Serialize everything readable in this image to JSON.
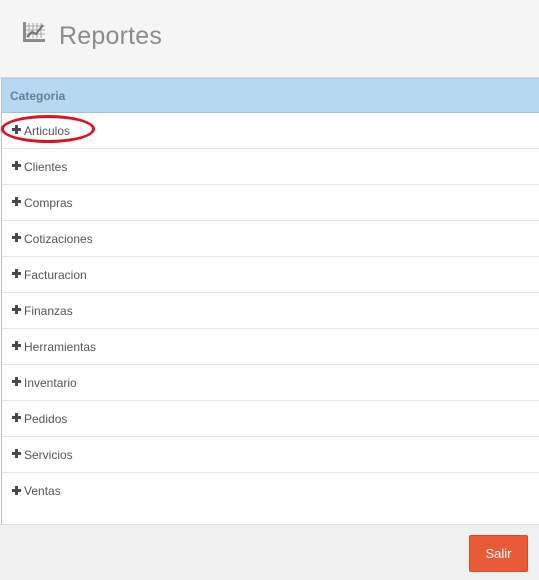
{
  "header": {
    "icon": "report-chart-icon",
    "title": "Reportes"
  },
  "table": {
    "column_header": "Categoria",
    "rows": [
      {
        "icon": "plus-icon",
        "label": "Articulos"
      },
      {
        "icon": "plus-icon",
        "label": "Clientes"
      },
      {
        "icon": "plus-icon",
        "label": "Compras"
      },
      {
        "icon": "plus-icon",
        "label": "Cotizaciones"
      },
      {
        "icon": "plus-icon",
        "label": "Facturacion"
      },
      {
        "icon": "plus-icon",
        "label": "Finanzas"
      },
      {
        "icon": "plus-icon",
        "label": "Herramientas"
      },
      {
        "icon": "plus-icon",
        "label": "Inventario"
      },
      {
        "icon": "plus-icon",
        "label": "Pedidos"
      },
      {
        "icon": "plus-icon",
        "label": "Servicios"
      },
      {
        "icon": "plus-icon",
        "label": "Ventas"
      }
    ]
  },
  "annotation": {
    "highlighted_row": "Articulos",
    "color": "#e0101f"
  },
  "footer": {
    "exit_label": "Salir"
  },
  "colors": {
    "header_bg": "#f5f5f5",
    "table_header_bg": "#b6d8f1",
    "exit_button": "#e95a37"
  }
}
